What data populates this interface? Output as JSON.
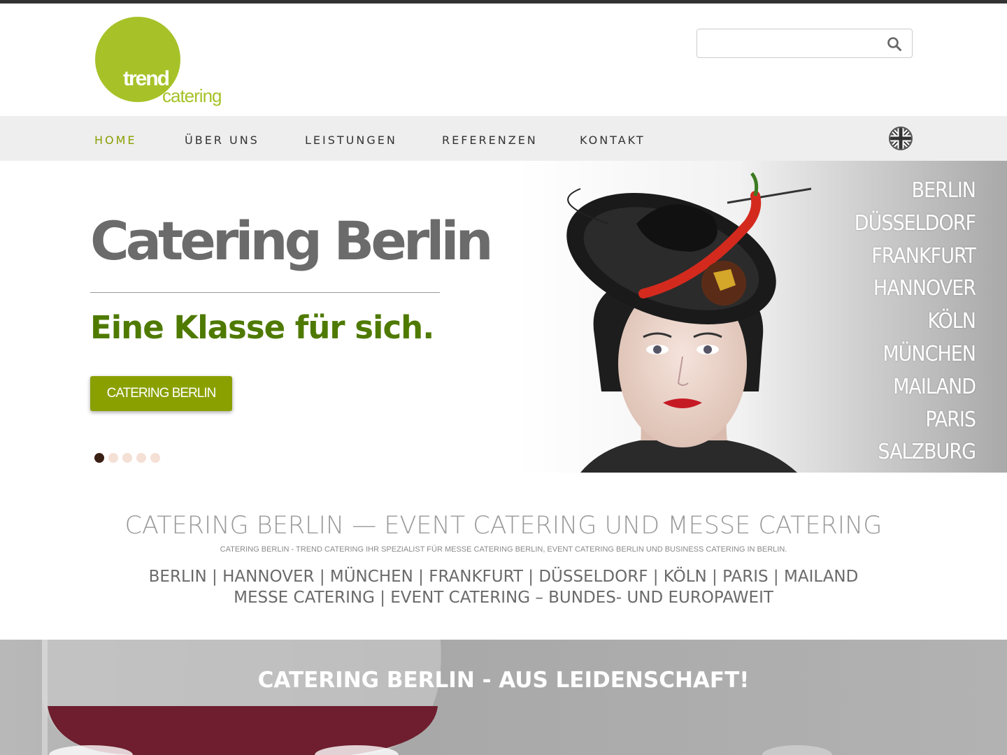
{
  "brand": {
    "logo_word_1": "trend",
    "logo_word_2": "catering",
    "logo_color": "#a6c228"
  },
  "search": {
    "placeholder": ""
  },
  "nav": {
    "items": [
      "HOME",
      "ÜBER UNS",
      "LEISTUNGEN",
      "REFERENZEN",
      "KONTAKT"
    ],
    "active": "HOME",
    "language_flag": "uk-flag-icon"
  },
  "hero": {
    "title": "Catering Berlin",
    "subtitle": "Eine Klasse für sich.",
    "button_label": "CATERING BERLIN",
    "accent_color": "#4f7a00",
    "button_color": "#8aa000",
    "slides_total": 5,
    "slide_active": 1,
    "cities": [
      "BERLIN",
      "DÜSSELDORF",
      "FRANKFURT",
      "HANNOVER",
      "KÖLN",
      "MÜNCHEN",
      "MAILAND",
      "PARIS",
      "SALZBURG"
    ]
  },
  "intro": {
    "title": "CATERING BERLIN — EVENT CATERING UND MESSE CATERING",
    "tagline": "CATERING BERLIN - TREND CATERING IHR SPEZIALIST FÜR MESSE CATERING BERLIN, EVENT CATERING BERLIN UND BUSINESS CATERING IN BERLIN.",
    "locations": "BERLIN | HANNOVER | MÜNCHEN | FRANKFURT | DÜSSELDORF | KÖLN | PARIS | MAILAND",
    "services": "MESSE CATERING | EVENT CATERING – BUNDES- UND EUROPAWEIT"
  },
  "banner": {
    "title": "CATERING BERLIN - AUS LEIDENSCHAFT!"
  }
}
